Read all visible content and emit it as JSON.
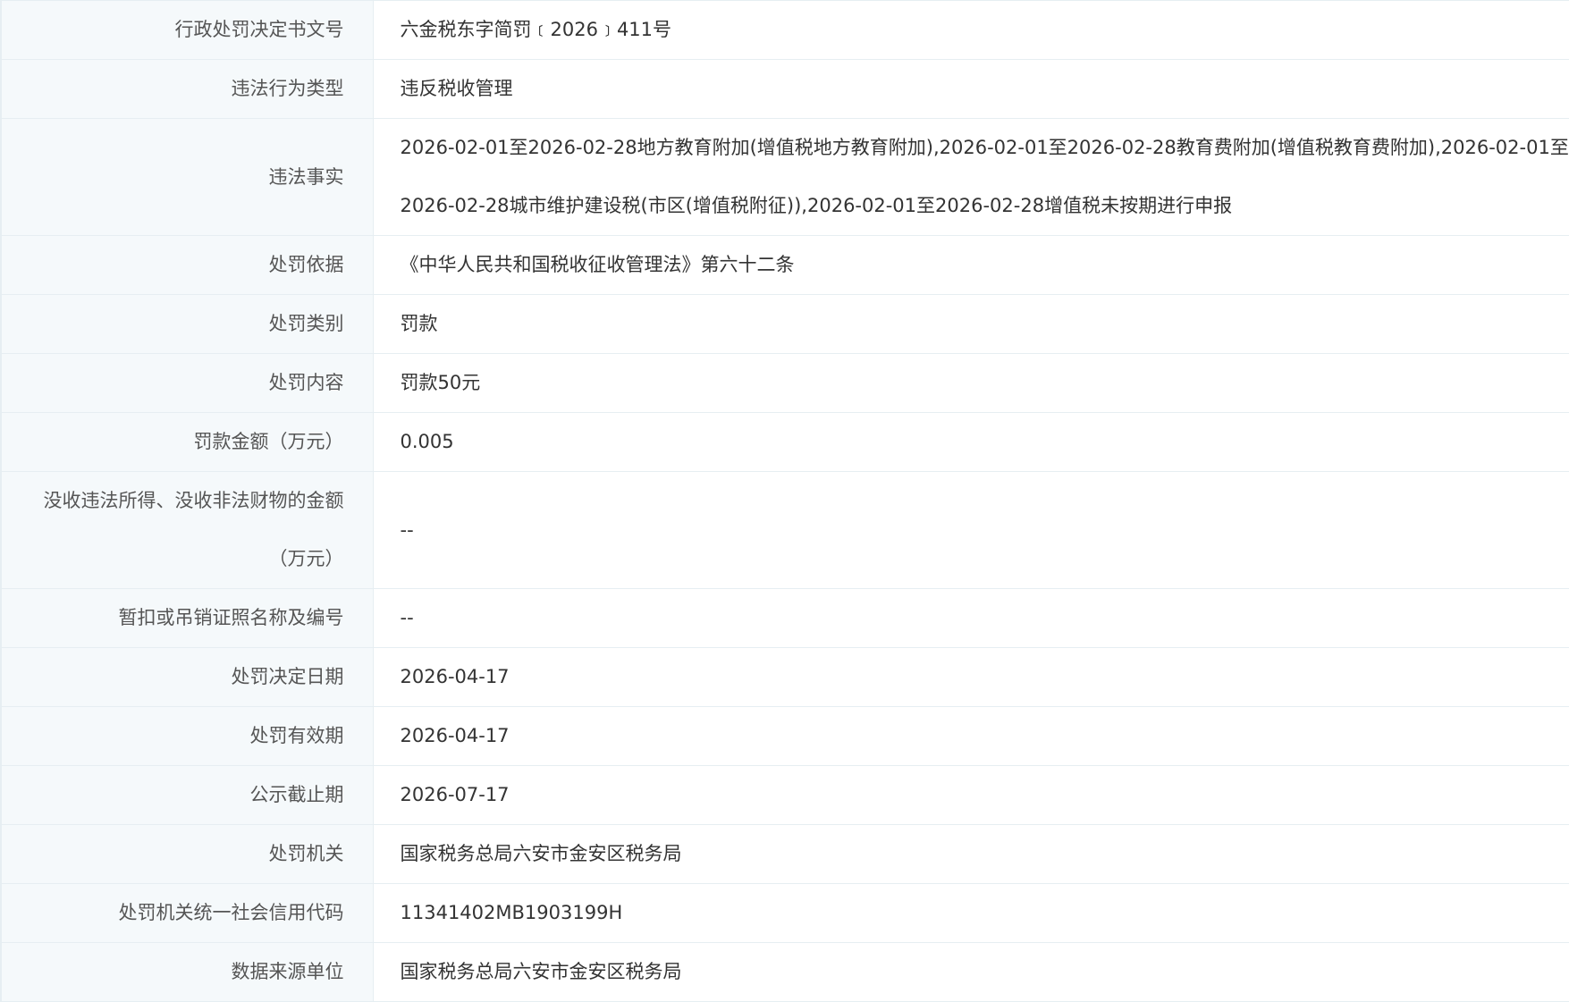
{
  "rows": [
    {
      "label": "行政处罚决定书文号",
      "value": "六金税东字简罚﹝2026﹞411号"
    },
    {
      "label": "违法行为类型",
      "value": "违反税收管理"
    },
    {
      "label": "违法事实",
      "value": "2026-02-01至2026-02-28地方教育附加(增值税地方教育附加),2026-02-01至2026-02-28教育费附加(增值税教育费附加),2026-02-01至2026-02-28城市维护建设税(市区(增值税附征)),2026-02-01至2026-02-28增值税未按期进行申报"
    },
    {
      "label": "处罚依据",
      "value": "《中华人民共和国税收征收管理法》第六十二条"
    },
    {
      "label": "处罚类别",
      "value": "罚款"
    },
    {
      "label": "处罚内容",
      "value": "罚款50元"
    },
    {
      "label": "罚款金额（万元）",
      "value": "0.005"
    },
    {
      "label": "没收违法所得、没收非法财物的金额（万元）",
      "value": "--"
    },
    {
      "label": "暂扣或吊销证照名称及编号",
      "value": "--"
    },
    {
      "label": "处罚决定日期",
      "value": "2026-04-17"
    },
    {
      "label": "处罚有效期",
      "value": "2026-04-17"
    },
    {
      "label": "公示截止期",
      "value": "2026-07-17"
    },
    {
      "label": "处罚机关",
      "value": "国家税务总局六安市金安区税务局"
    },
    {
      "label": "处罚机关统一社会信用代码",
      "value": "11341402MB1903199H"
    },
    {
      "label": "数据来源单位",
      "value": "国家税务总局六安市金安区税务局"
    }
  ]
}
